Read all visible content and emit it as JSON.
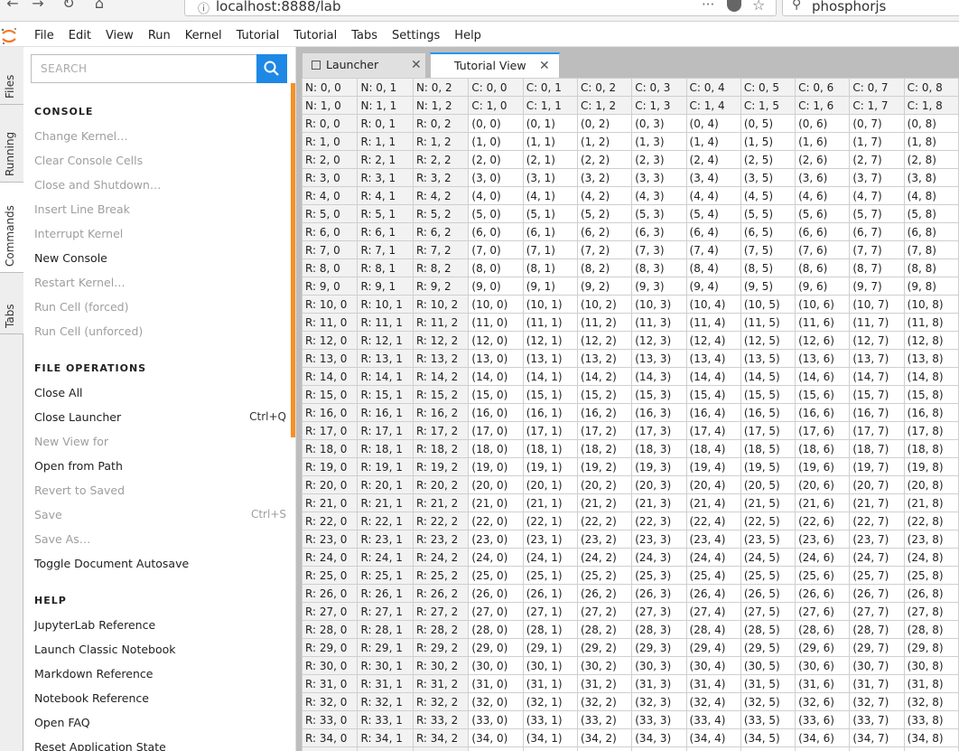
{
  "browser": {
    "url_info_icon": "info-icon",
    "url": "localhost:8888/lab",
    "search_value": "phosphorjs"
  },
  "menubar": {
    "items": [
      "File",
      "Edit",
      "View",
      "Run",
      "Kernel",
      "Tutorial",
      "Tutorial",
      "Tabs",
      "Settings",
      "Help"
    ]
  },
  "left_tabs": [
    "Files",
    "Running",
    "Commands",
    "Tabs"
  ],
  "palette": {
    "search_placeholder": "SEARCH",
    "categories": [
      {
        "name": "CONSOLE",
        "commands": [
          {
            "label": "Change Kernel…",
            "enabled": false,
            "shortcut": ""
          },
          {
            "label": "Clear Console Cells",
            "enabled": false,
            "shortcut": ""
          },
          {
            "label": "Close and Shutdown…",
            "enabled": false,
            "shortcut": ""
          },
          {
            "label": "Insert Line Break",
            "enabled": false,
            "shortcut": ""
          },
          {
            "label": "Interrupt Kernel",
            "enabled": false,
            "shortcut": ""
          },
          {
            "label": "New Console",
            "enabled": true,
            "shortcut": ""
          },
          {
            "label": "Restart Kernel…",
            "enabled": false,
            "shortcut": ""
          },
          {
            "label": "Run Cell (forced)",
            "enabled": false,
            "shortcut": ""
          },
          {
            "label": "Run Cell (unforced)",
            "enabled": false,
            "shortcut": ""
          }
        ]
      },
      {
        "name": "FILE OPERATIONS",
        "commands": [
          {
            "label": "Close All",
            "enabled": true,
            "shortcut": ""
          },
          {
            "label": "Close Launcher",
            "enabled": true,
            "shortcut": "Ctrl+Q"
          },
          {
            "label": "New View for",
            "enabled": false,
            "shortcut": ""
          },
          {
            "label": "Open from Path",
            "enabled": true,
            "shortcut": ""
          },
          {
            "label": "Revert to Saved",
            "enabled": false,
            "shortcut": ""
          },
          {
            "label": "Save",
            "enabled": false,
            "shortcut": "Ctrl+S"
          },
          {
            "label": "Save As…",
            "enabled": false,
            "shortcut": ""
          },
          {
            "label": "Toggle Document Autosave",
            "enabled": true,
            "shortcut": ""
          }
        ]
      },
      {
        "name": "HELP",
        "commands": [
          {
            "label": "JupyterLab Reference",
            "enabled": true,
            "shortcut": ""
          },
          {
            "label": "Launch Classic Notebook",
            "enabled": true,
            "shortcut": ""
          },
          {
            "label": "Markdown Reference",
            "enabled": true,
            "shortcut": ""
          },
          {
            "label": "Notebook Reference",
            "enabled": true,
            "shortcut": ""
          },
          {
            "label": "Open FAQ",
            "enabled": true,
            "shortcut": ""
          },
          {
            "label": "Reset Application State",
            "enabled": true,
            "shortcut": ""
          }
        ]
      }
    ]
  },
  "tabs": [
    {
      "label": "Launcher",
      "active": false
    },
    {
      "label": "Tutorial View",
      "active": true
    }
  ],
  "grid": {
    "header_rows": [
      [
        "N: 0, 0",
        "N: 0, 1",
        "N: 0, 2",
        "C: 0, 0",
        "C: 0, 1",
        "C: 0, 2",
        "C: 0, 3",
        "C: 0, 4",
        "C: 0, 5",
        "C: 0, 6",
        "C: 0, 7",
        "C: 0, 8"
      ],
      [
        "N: 1, 0",
        "N: 1, 1",
        "N: 1, 2",
        "C: 1, 0",
        "C: 1, 1",
        "C: 1, 2",
        "C: 1, 3",
        "C: 1, 4",
        "C: 1, 5",
        "C: 1, 6",
        "C: 1, 7",
        "C: 1, 8"
      ]
    ],
    "row_header_count": 3,
    "body_rows": 36,
    "body_cols": 9
  }
}
